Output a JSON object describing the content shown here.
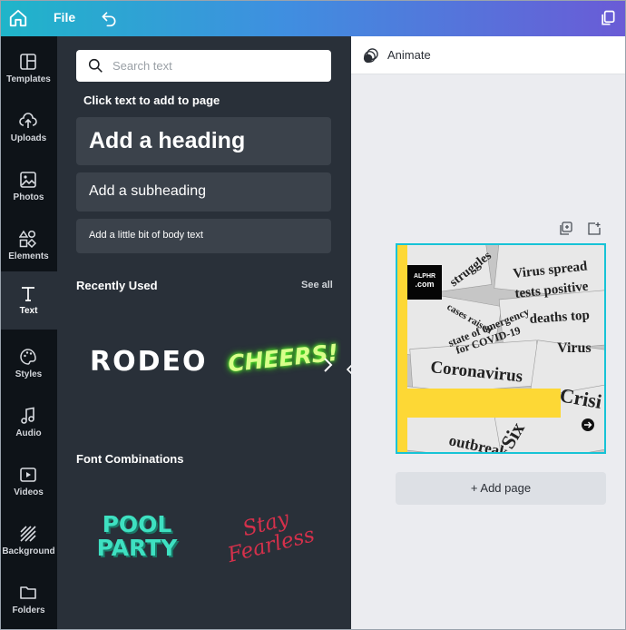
{
  "topbar": {
    "file_label": "File",
    "icons": [
      "home-icon",
      "undo-icon",
      "duplicate-icon"
    ]
  },
  "rail": [
    {
      "label": "Templates",
      "icon": "templates-icon"
    },
    {
      "label": "Uploads",
      "icon": "upload-icon"
    },
    {
      "label": "Photos",
      "icon": "photo-icon"
    },
    {
      "label": "Elements",
      "icon": "elements-icon"
    },
    {
      "label": "Text",
      "icon": "text-icon",
      "active": true
    },
    {
      "label": "Styles",
      "icon": "palette-icon"
    },
    {
      "label": "Audio",
      "icon": "music-icon"
    },
    {
      "label": "Videos",
      "icon": "video-icon"
    },
    {
      "label": "Background",
      "icon": "background-icon"
    },
    {
      "label": "Folders",
      "icon": "folder-icon"
    }
  ],
  "panel": {
    "search_placeholder": "Search text",
    "hint": "Click text to add to page",
    "heading": "Add a heading",
    "subheading": "Add a subheading",
    "body": "Add a little bit of body text",
    "recently_used_title": "Recently Used",
    "see_all": "See all",
    "recent": [
      "RODEO",
      "CHEERS!"
    ],
    "font_combos_title": "Font Combinations",
    "combos": [
      {
        "line1": "POOL",
        "line2": "PARTY"
      },
      {
        "line1": "Stay",
        "line2": "Fearless"
      }
    ]
  },
  "workspace": {
    "animate_label": "Animate",
    "add_page_label": "+ Add page",
    "design": {
      "logo_line1": "ALPHR",
      "logo_line2": ".com",
      "headlines": [
        "Virus spread",
        "struggles",
        "tests positive",
        "deaths top",
        "state of emergency",
        "for COVID-19",
        "Coronavirus",
        "Virus",
        "Crisi",
        "outbreak",
        "Six",
        "cases raised"
      ]
    }
  },
  "colors": {
    "accent": "#17c3d6",
    "yellow": "#fdd835",
    "panel": "#293039",
    "rail": "#0e1318"
  }
}
